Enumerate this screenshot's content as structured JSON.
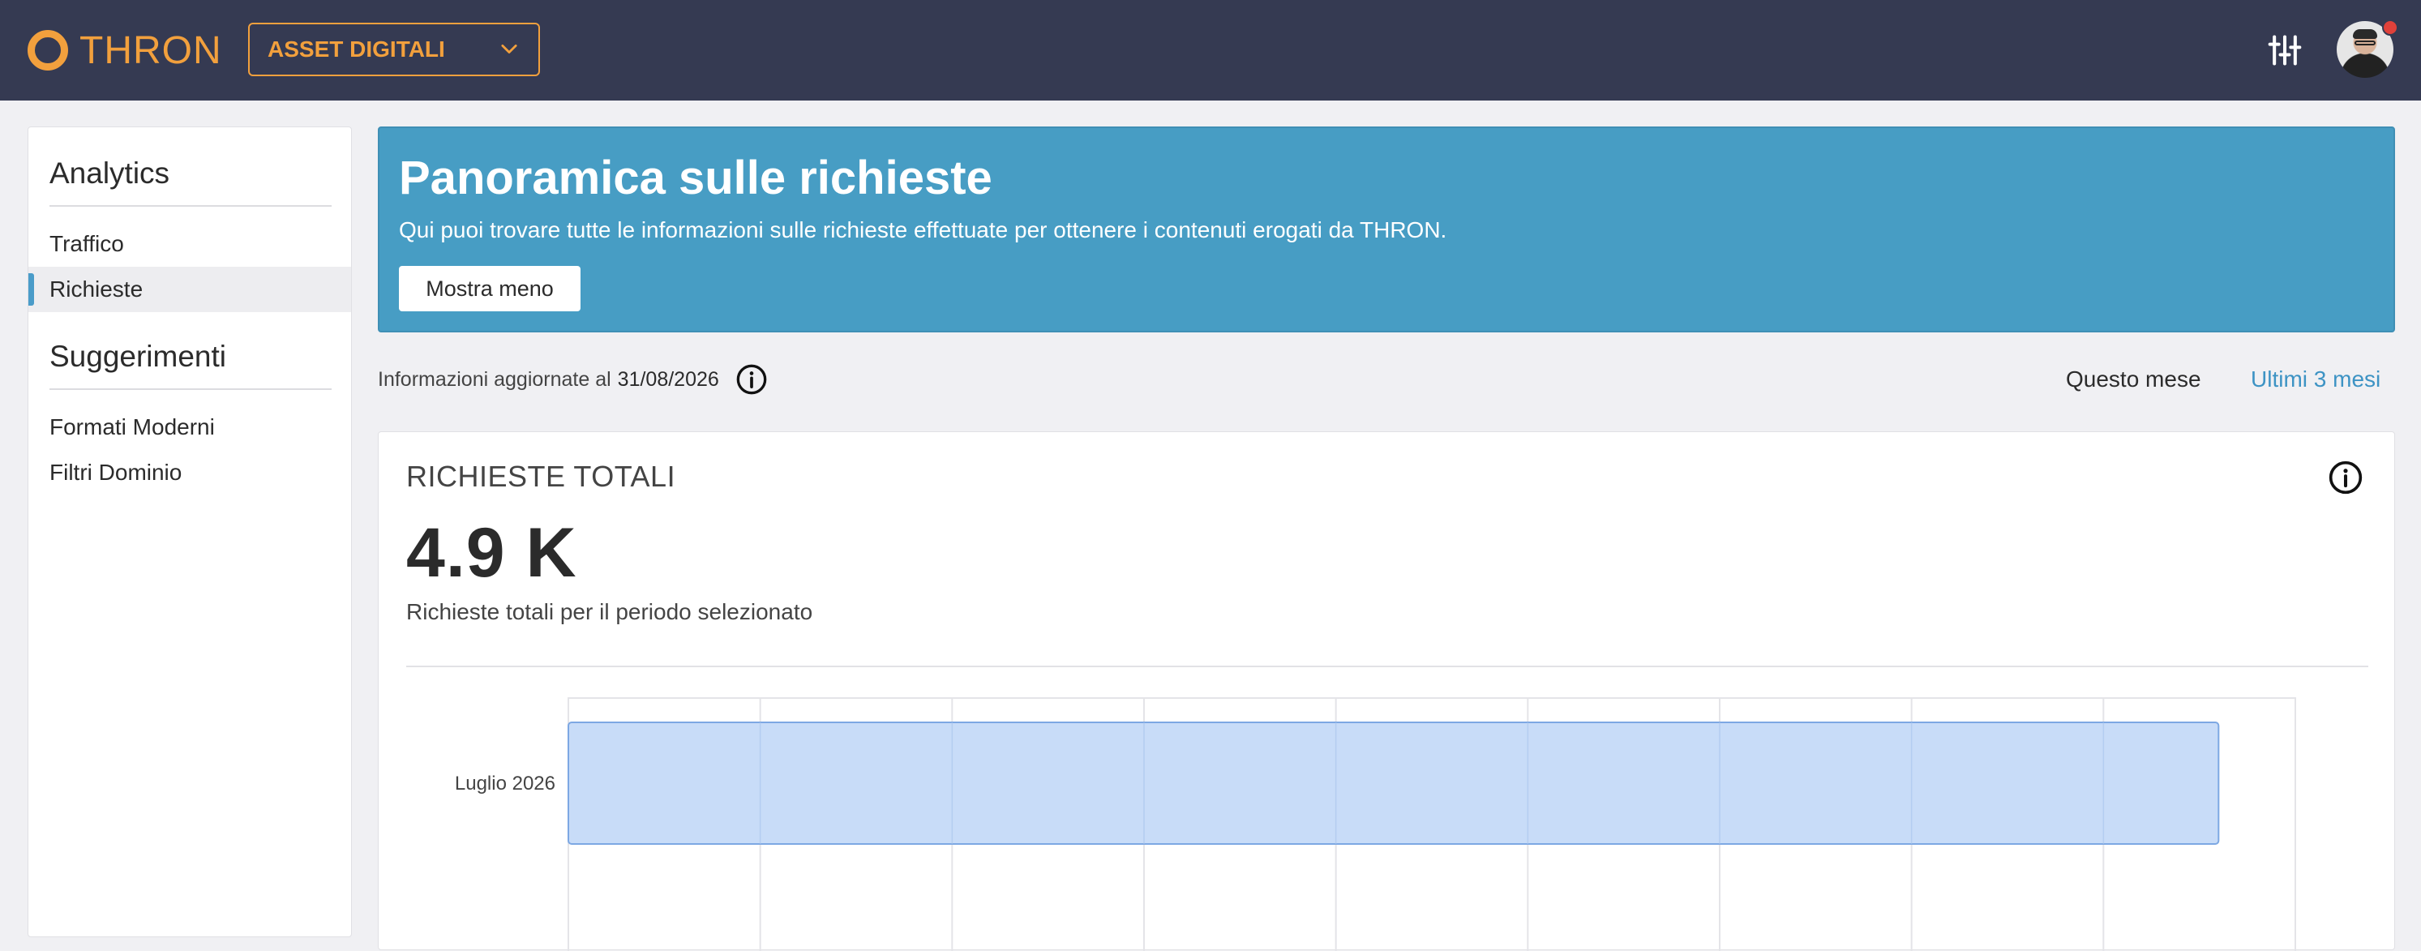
{
  "header": {
    "logo_text": "THRON",
    "asset_selector": "ASSET DIGITALI",
    "brand_color": "#f2a03d",
    "icons": [
      "filters-icon",
      "avatar"
    ]
  },
  "sidebar": {
    "sections": [
      {
        "title": "Analytics",
        "items": [
          {
            "label": "Traffico",
            "active": false
          },
          {
            "label": "Richieste",
            "active": true
          }
        ]
      },
      {
        "title": "Suggerimenti",
        "items": [
          {
            "label": "Formati Moderni",
            "active": false
          },
          {
            "label": "Filtri Dominio",
            "active": false
          }
        ]
      }
    ]
  },
  "banner": {
    "title": "Panoramica sulle richieste",
    "description": "Qui puoi trovare tutte le informazioni sulle richieste effettuate per ottenere i contenuti erogati da THRON.",
    "button_label": "Mostra meno",
    "color": "#479dc4"
  },
  "info": {
    "prefix": "Informazioni aggiornate al",
    "date": "31/08/2026",
    "periods": [
      "Questo mese",
      "Ultimi 3 mesi"
    ],
    "active_period": "Ultimi 3 mesi",
    "active_color": "#3d93c4"
  },
  "card": {
    "title": "RICHIESTE TOTALI",
    "value": "4.9 K",
    "subtitle": "Richieste totali per il periodo selezionato"
  },
  "chart_data": {
    "type": "bar",
    "orientation": "horizontal",
    "categories": [
      "Luglio 2026"
    ],
    "values": [
      4300
    ],
    "xlim": [
      0,
      4500
    ],
    "grid": true,
    "bar_color": "#c3d9f7",
    "bar_border": "#7da8e3"
  }
}
